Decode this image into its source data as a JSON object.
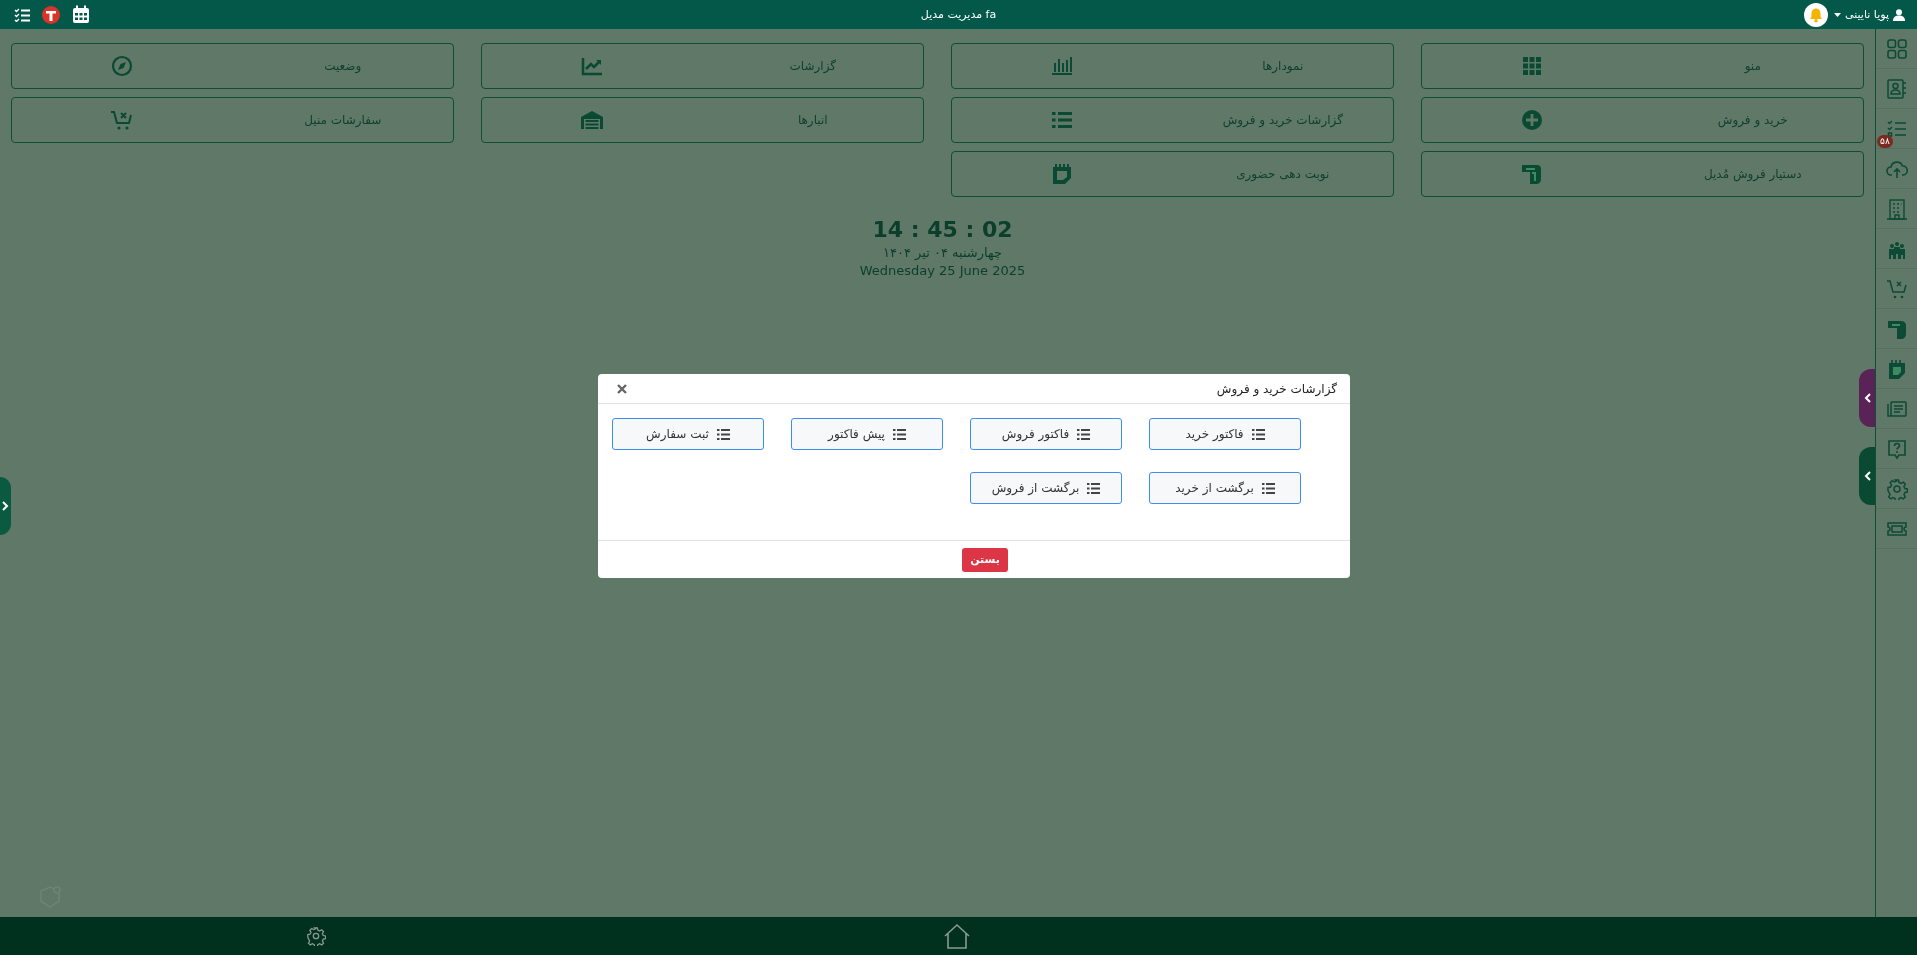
{
  "top_bar": {
    "title": "مدیریت مدیل fa",
    "user_name": "پویا نایینی"
  },
  "tiles": [
    {
      "label": "منو",
      "kind": "menu"
    },
    {
      "label": "نمودارها",
      "kind": "charts"
    },
    {
      "label": "گزارشات",
      "kind": "reports"
    },
    {
      "label": "وضعیت",
      "kind": "status"
    },
    {
      "label": "خرید و فروش",
      "kind": "trade"
    },
    {
      "label": "گزارشات خرید و فروش",
      "kind": "trade-reports"
    },
    {
      "label": "انبارها",
      "kind": "warehouses"
    },
    {
      "label": "سفارشات منیل",
      "kind": "orders"
    },
    {
      "label": "دستیار فروش مُدیل",
      "kind": "assistant"
    },
    {
      "label": "نوبت دهی حضوری",
      "kind": "appointments"
    }
  ],
  "clock": {
    "time": "14 : 45 : 02",
    "persian_date": "چهارشنبه ۰۴ تیر ۱۴۰۴",
    "date": "Wednesday 25 June 2025"
  },
  "sidebar": {
    "items": [
      {
        "kind": "apps"
      },
      {
        "kind": "contacts"
      },
      {
        "kind": "tasks",
        "badge": "۵۸"
      },
      {
        "kind": "cloud"
      },
      {
        "kind": "building"
      },
      {
        "kind": "team"
      },
      {
        "kind": "cart"
      },
      {
        "kind": "assistant"
      },
      {
        "kind": "appointments"
      },
      {
        "kind": "receipt"
      },
      {
        "kind": "help"
      },
      {
        "kind": "settings"
      },
      {
        "kind": "ticket"
      }
    ]
  },
  "modal": {
    "title": "گزارشات خرید و فروش",
    "buttons": [
      "فاکتور خرید",
      "فاکتور فروش",
      "پیش فاکتور",
      "ثبت سفارش",
      "برگشت از خرید",
      "برگشت از فروش"
    ],
    "close_label": "بستن"
  }
}
